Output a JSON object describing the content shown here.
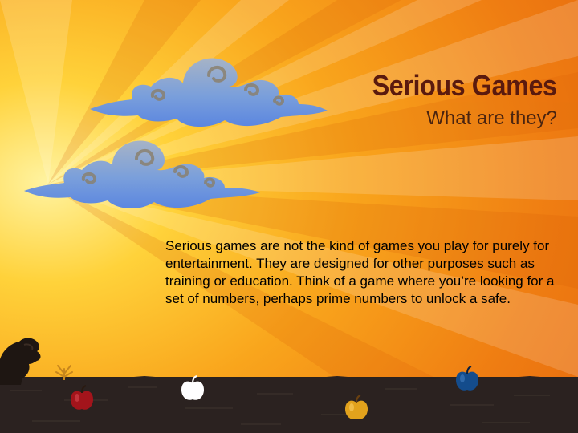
{
  "slide": {
    "title": "Serious Games",
    "subtitle": "What are they?",
    "body": "Serious games are not the kind of games you play for purely for entertainment. They are designed for other purposes such as training or education. Think of a game where you’re looking for a set of numbers, perhaps prime numbers to unlock a safe."
  },
  "colors": {
    "title": "#5a1a0e",
    "cloud": "#5f8fdc",
    "apple_red": "#a3141b",
    "apple_white": "#ffffff",
    "apple_gold": "#e2a21c",
    "apple_blue": "#144c8c",
    "ground": "#231b17"
  },
  "icons": [
    "cloud-icon",
    "cloud-icon",
    "character-silhouette-icon",
    "apple-icon",
    "apple-icon",
    "apple-icon",
    "apple-icon",
    "plant-sprout-icon"
  ]
}
